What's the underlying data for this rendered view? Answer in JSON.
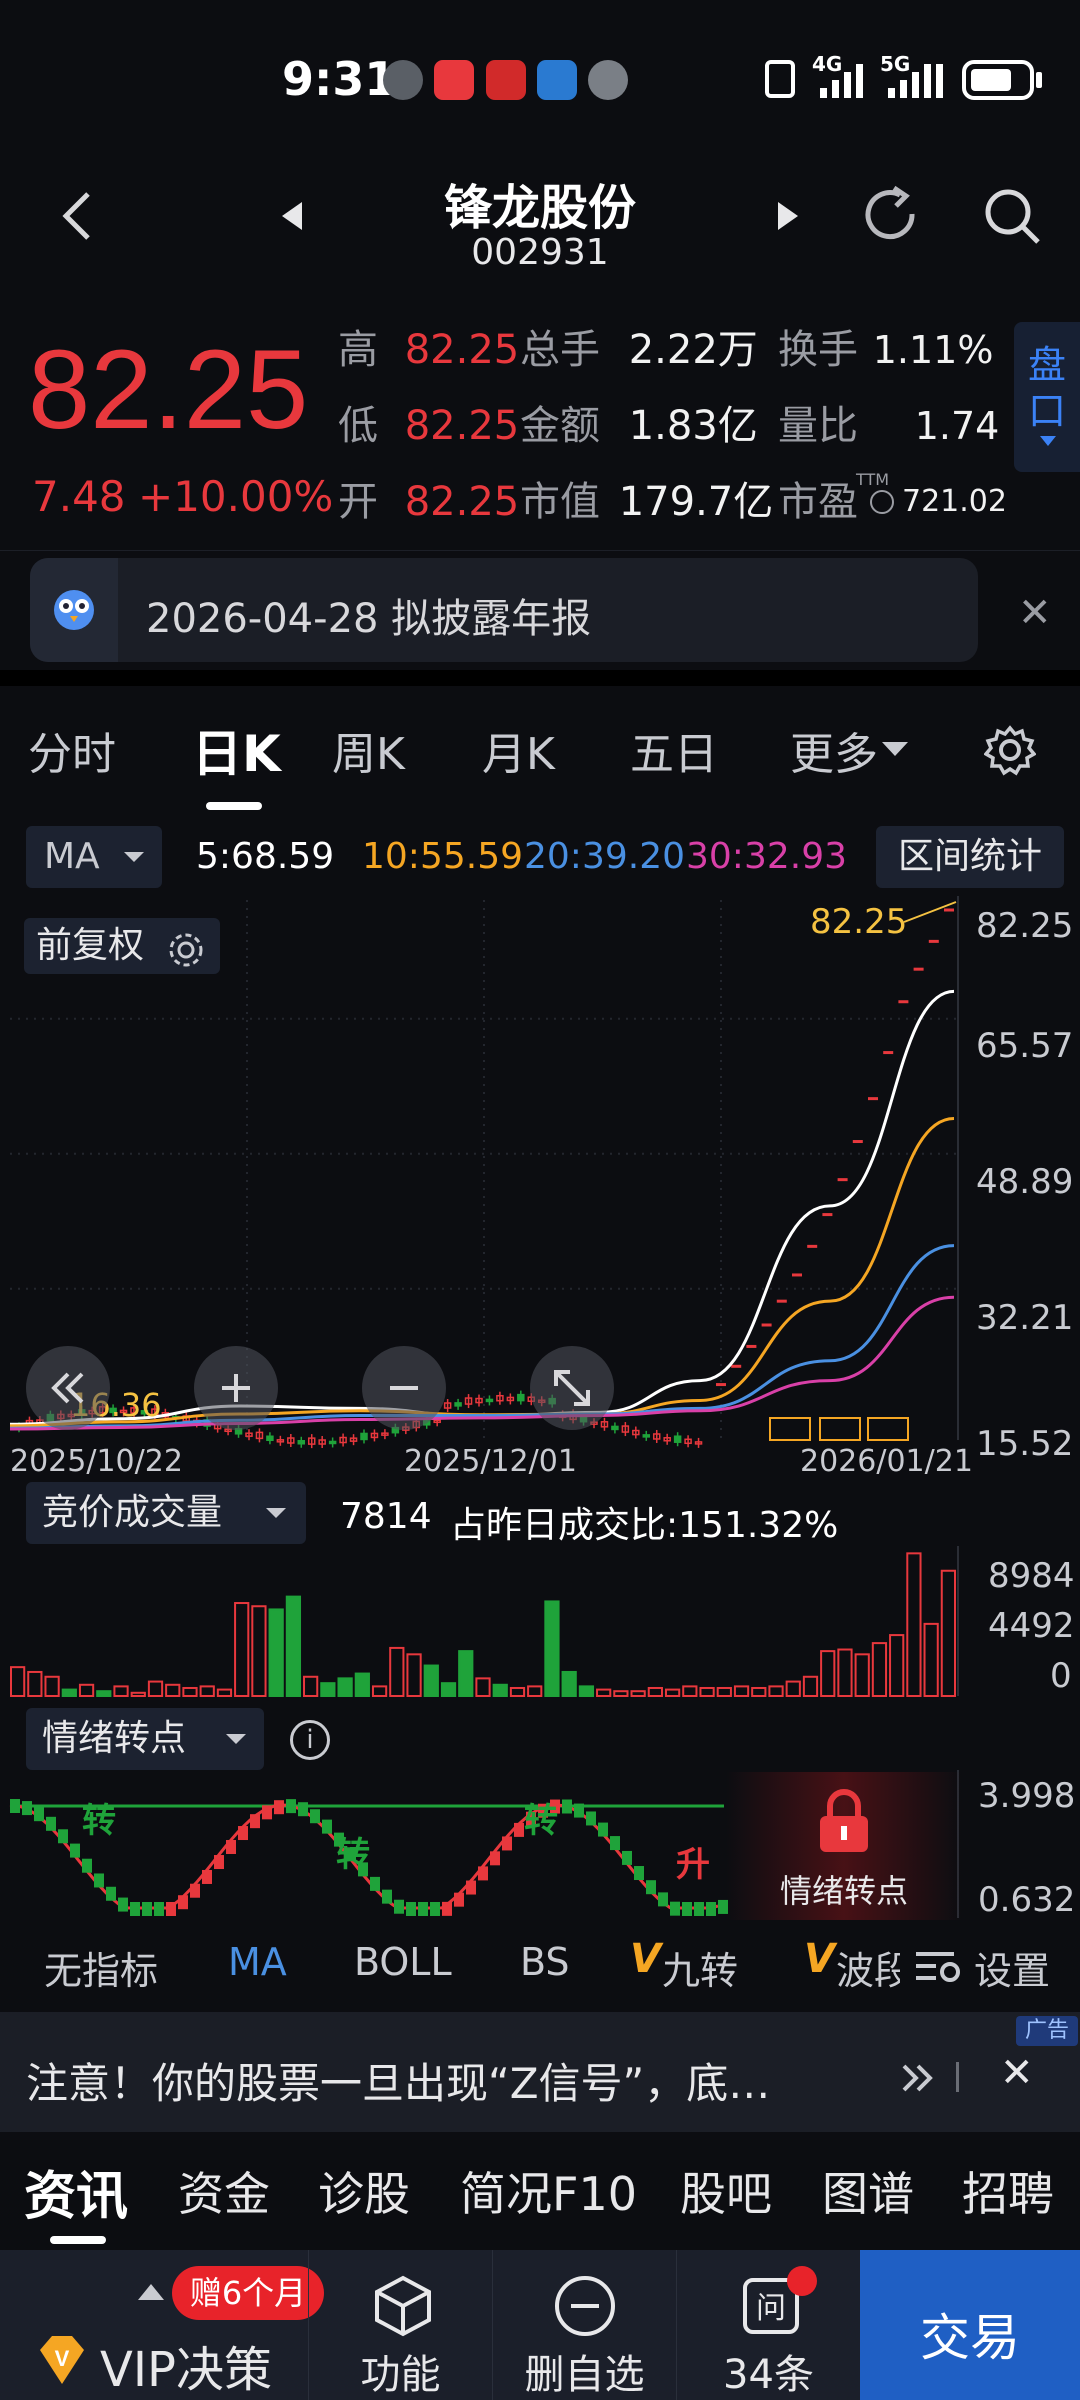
{
  "status_bar": {
    "time": "9:31",
    "net1": "4G",
    "net2": "5G"
  },
  "header": {
    "title": "锋龙股份",
    "code": "002931"
  },
  "quote": {
    "price": "82.25",
    "change": "7.48",
    "change_pct": "+10.00%",
    "high_label": "高",
    "high": "82.25",
    "low_label": "低",
    "low": "82.25",
    "open_label": "开",
    "open": "82.25",
    "vol_label": "总手",
    "vol": "2.22万",
    "amount_label": "金额",
    "amount": "1.83亿",
    "mcap_label": "市值",
    "mcap": "179.7亿",
    "turnover_label": "换手",
    "turnover": "1.11%",
    "vratio_label": "量比",
    "vratio": "1.74",
    "pe_label": "市盈",
    "pe_sup": "TTM",
    "pe": "721.02",
    "panel_label1": "盘",
    "panel_label2": "口"
  },
  "banner": {
    "text": "2026-04-28 拟披露年报"
  },
  "tabs": [
    "分时",
    "日K",
    "周K",
    "月K",
    "五日",
    "更多"
  ],
  "ma_bar": {
    "selector": "MA",
    "ma5": "5:68.59",
    "ma10": "10:55.59",
    "ma20": "20:39.20",
    "ma30": "30:32.93",
    "range_btn": "区间统计"
  },
  "chart_labels": {
    "adjust": "前复权",
    "max_marker": "82.25",
    "min_marker": "16.36"
  },
  "colors": {
    "up": "#e8383d",
    "down": "#1fa33a",
    "ma5": "#ffffff",
    "ma10": "#f5a623",
    "ma20": "#4a90e2",
    "ma30": "#d940a8",
    "accent_blue": "#1f5fc4"
  },
  "chart_data": [
    {
      "type": "line",
      "title": "",
      "xlabel": "",
      "ylabel": "",
      "x": [
        "2025/10/22",
        "2025/12/01",
        "2026/01/21"
      ],
      "y_ticks": [
        "82.25",
        "65.57",
        "48.89",
        "32.21",
        "15.52"
      ],
      "ylim": [
        15.52,
        82.25
      ],
      "series": [
        {
          "name": "MA5",
          "values": [
            17.5,
            18.2,
            19.8,
            19.5,
            18.5,
            19.0,
            23.0,
            45.0,
            72.0
          ]
        },
        {
          "name": "MA10",
          "values": [
            17.3,
            17.8,
            18.8,
            19.2,
            18.7,
            18.8,
            20.5,
            33.0,
            56.0
          ]
        },
        {
          "name": "MA20",
          "values": [
            17.0,
            17.3,
            18.0,
            18.6,
            18.6,
            18.8,
            19.5,
            25.5,
            40.0
          ]
        },
        {
          "name": "MA30",
          "values": [
            16.9,
            17.1,
            17.6,
            18.1,
            18.3,
            18.6,
            19.2,
            23.0,
            33.5
          ]
        }
      ],
      "limit_up_closes": [
        22.5,
        24.8,
        27.3,
        30.0,
        33.0,
        36.3,
        39.9,
        43.9,
        48.3,
        53.1,
        58.5,
        64.3,
        70.7,
        74.8,
        78.3,
        82.25
      ]
    },
    {
      "type": "bar",
      "title": "竞价成交量",
      "y_ticks": [
        "8984",
        "4492",
        "0"
      ],
      "ylim": [
        0,
        8984
      ],
      "values": [
        1800,
        1500,
        1200,
        400,
        700,
        300,
        600,
        200,
        900,
        700,
        500,
        600,
        400,
        5800,
        5600,
        5400,
        6200,
        1200,
        800,
        1100,
        1400,
        600,
        3000,
        2600,
        1900,
        800,
        2800,
        1100,
        700,
        500,
        600,
        5900,
        1500,
        600,
        400,
        300,
        300,
        500,
        400,
        600,
        500,
        500,
        600,
        500,
        600,
        900,
        1200,
        2800,
        2900,
        2600,
        3300,
        3800,
        8900,
        4500,
        7814
      ],
      "up": [
        true,
        true,
        true,
        false,
        true,
        false,
        true,
        true,
        true,
        true,
        true,
        true,
        true,
        true,
        true,
        false,
        false,
        true,
        false,
        false,
        false,
        true,
        true,
        true,
        false,
        false,
        false,
        true,
        false,
        true,
        true,
        false,
        false,
        false,
        true,
        true,
        true,
        true,
        true,
        true,
        true,
        true,
        true,
        true,
        true,
        true,
        true,
        true,
        true,
        true,
        true,
        true,
        true,
        true,
        true
      ]
    },
    {
      "type": "line",
      "title": "情绪转点",
      "y_ticks": [
        "3.998",
        "0.632"
      ],
      "ylim": [
        0.632,
        3.998
      ]
    }
  ],
  "volume_bar": {
    "selector": "竞价成交量",
    "value": "7814",
    "ratio": "占昨日成交比:151.32%",
    "ticks": [
      "8984",
      "4492",
      "0"
    ]
  },
  "emotion_bar": {
    "selector": "情绪转点",
    "locked_label": "情绪转点",
    "ticks": [
      "3.998",
      "0.632"
    ],
    "marks": [
      "转",
      "转",
      "转",
      "升"
    ]
  },
  "indicators": [
    "无指标",
    "MA",
    "BOLL",
    "BS",
    "九转",
    "波段",
    "设置"
  ],
  "ad": {
    "tag": "广告",
    "text": "注意！你的股票一旦出现“Z信号”，底…"
  },
  "nav_tabs": [
    "资讯",
    "资金",
    "诊股",
    "简况F10",
    "股吧",
    "图谱",
    "招聘"
  ],
  "footer": {
    "vip": "VIP决策",
    "gift": "赠6个月",
    "func": "功能",
    "delete": "删自选",
    "count": "34条",
    "trade": "交易"
  },
  "x_dates": [
    "2025/10/22",
    "2025/12/01",
    "2026/01/21"
  ],
  "price_ticks": [
    "82.25",
    "65.57",
    "48.89",
    "32.21",
    "15.52"
  ]
}
